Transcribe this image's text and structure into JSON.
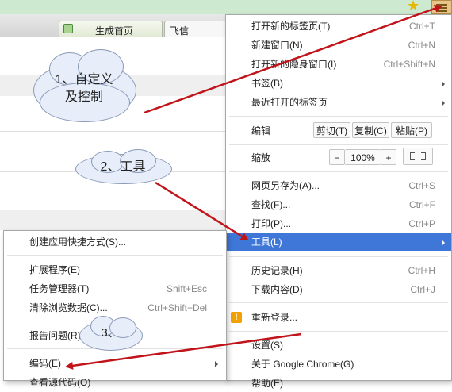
{
  "browser": {
    "tabs": [
      {
        "label": "生成首页"
      },
      {
        "label": "飞信"
      }
    ]
  },
  "main_menu": {
    "items": [
      {
        "label": "打开新的标签页(T)",
        "shortcut": "Ctrl+T"
      },
      {
        "label": "新建窗口(N)",
        "shortcut": "Ctrl+N"
      },
      {
        "label": "打开新的隐身窗口(I)",
        "shortcut": "Ctrl+Shift+N"
      },
      {
        "label": "书签(B)"
      },
      {
        "label": "最近打开的标签页"
      },
      {
        "label": "编辑",
        "cut": "剪切(T)",
        "copy": "复制(C)",
        "paste": "粘贴(P)"
      },
      {
        "label": "缩放",
        "minus": "−",
        "zoom": "100%",
        "plus": "+"
      },
      {
        "label": "网页另存为(A)...",
        "shortcut": "Ctrl+S"
      },
      {
        "label": "查找(F)...",
        "shortcut": "Ctrl+F"
      },
      {
        "label": "打印(P)...",
        "shortcut": "Ctrl+P"
      },
      {
        "label": "工具(L)"
      },
      {
        "label": "历史记录(H)",
        "shortcut": "Ctrl+H"
      },
      {
        "label": "下载内容(D)",
        "shortcut": "Ctrl+J"
      },
      {
        "label": "重新登录..."
      },
      {
        "label": "设置(S)"
      },
      {
        "label": "关于 Google Chrome(G)"
      },
      {
        "label": "帮助(E)"
      }
    ]
  },
  "tools_submenu": {
    "items": [
      {
        "label": "创建应用快捷方式(S)..."
      },
      {
        "label": "扩展程序(E)"
      },
      {
        "label": "任务管理器(T)",
        "shortcut": "Shift+Esc"
      },
      {
        "label": "清除浏览数据(C)...",
        "shortcut": "Ctrl+Shift+Del"
      },
      {
        "label": "报告问题(R)..."
      },
      {
        "label": "编码(E)"
      },
      {
        "label": "查看源代码(O)"
      }
    ]
  },
  "callouts": {
    "c1": "1、自定义\n及控制",
    "c2": "2、工具",
    "c3": "3、"
  },
  "colors": {
    "highlight": "#3f77d9",
    "annotation_arrow": "#c0141a"
  }
}
